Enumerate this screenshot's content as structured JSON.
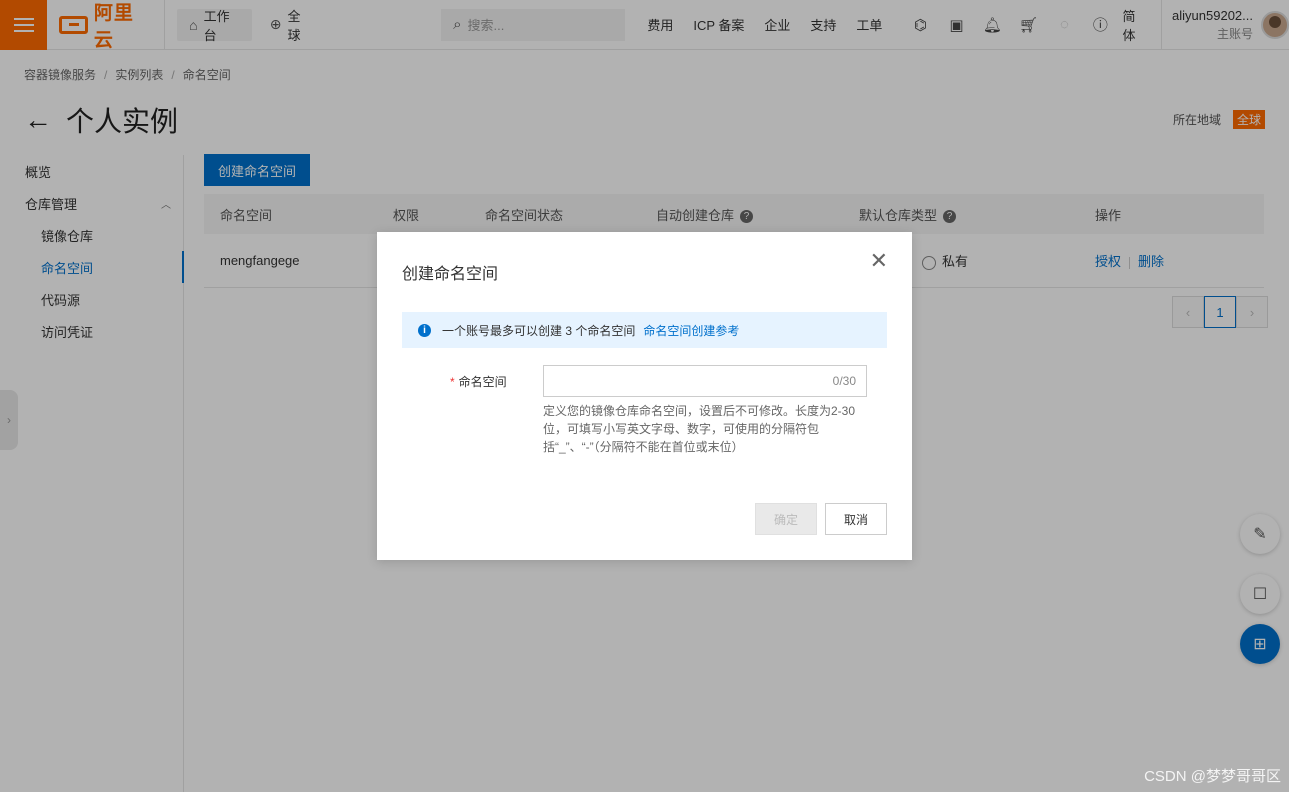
{
  "topbar": {
    "logo_text": "阿里云",
    "workbench": "工作台",
    "global": "全球",
    "search_placeholder": "搜索...",
    "links": [
      "费用",
      "ICP 备案",
      "企业",
      "支持",
      "工单"
    ],
    "icons": [
      "terminal-icon",
      "console-icon",
      "bell-icon",
      "cart-icon",
      "bulb-icon",
      "help-icon"
    ],
    "lang": "简体",
    "username": "aliyun59202...",
    "account_type": "主账号"
  },
  "breadcrumb": [
    "容器镜像服务",
    "实例列表",
    "命名空间"
  ],
  "page": {
    "title": "个人实例",
    "region_label": "所在地域",
    "region_value": "全球"
  },
  "sidebar": {
    "overview": "概览",
    "repo_mgmt": "仓库管理",
    "items": [
      "镜像仓库",
      "命名空间",
      "代码源",
      "访问凭证"
    ]
  },
  "main": {
    "create_button": "创建命名空间",
    "columns": [
      "命名空间",
      "权限",
      "命名空间状态",
      "自动创建仓库",
      "默认仓库类型",
      "操作"
    ],
    "rows": [
      {
        "namespace": "mengfangege",
        "repo_type": "私有",
        "action_auth": "授权",
        "action_delete": "删除"
      }
    ],
    "page_number": "1"
  },
  "modal": {
    "title": "创建命名空间",
    "notice_text": "一个账号最多可以创建 3 个命名空间",
    "notice_link": "命名空间创建参考",
    "field_label": "命名空间",
    "field_value": "",
    "counter": "0/30",
    "hint": "定义您的镜像仓库命名空间，设置后不可修改。长度为2-30位，可填写小写英文字母、数字，可使用的分隔符包括“_”、“-”（分隔符不能在首位或末位）",
    "ok_button": "确定",
    "cancel_button": "取消"
  },
  "watermark": "CSDN @梦梦哥哥区",
  "colors": {
    "brand": "#ff6a00",
    "primary": "#0070cc"
  }
}
